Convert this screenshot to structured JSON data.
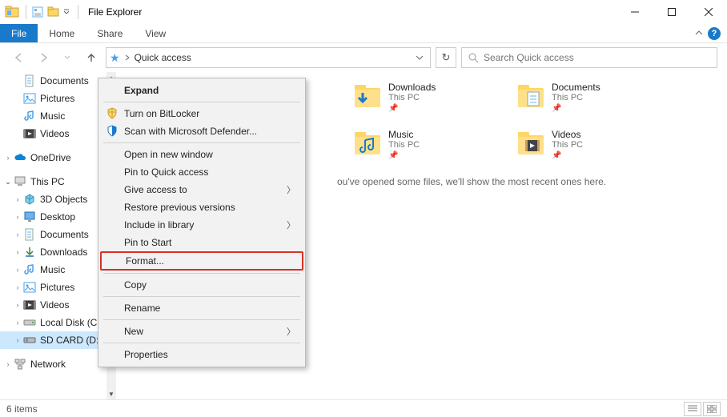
{
  "titlebar": {
    "title": "File Explorer"
  },
  "ribbon": {
    "file": "File",
    "tabs": [
      "Home",
      "Share",
      "View"
    ]
  },
  "address": {
    "location": "Quick access"
  },
  "search": {
    "placeholder": "Search Quick access"
  },
  "tree": {
    "qa": [
      {
        "label": "Documents",
        "icon": "doc"
      },
      {
        "label": "Pictures",
        "icon": "pic"
      },
      {
        "label": "Music",
        "icon": "music"
      },
      {
        "label": "Videos",
        "icon": "video"
      }
    ],
    "onedrive": "OneDrive",
    "thispc": "This PC",
    "pc": [
      {
        "label": "3D Objects",
        "icon": "3d"
      },
      {
        "label": "Desktop",
        "icon": "desktop"
      },
      {
        "label": "Documents",
        "icon": "doc"
      },
      {
        "label": "Downloads",
        "icon": "down"
      },
      {
        "label": "Music",
        "icon": "music"
      },
      {
        "label": "Pictures",
        "icon": "pic"
      },
      {
        "label": "Videos",
        "icon": "video"
      },
      {
        "label": "Local Disk (C:)",
        "icon": "disk"
      },
      {
        "label": "SD CARD (D:)",
        "icon": "sd"
      }
    ],
    "network": "Network"
  },
  "frequent": [
    {
      "name": "Downloads",
      "sub": "This PC",
      "icon": "down"
    },
    {
      "name": "Documents",
      "sub": "This PC",
      "icon": "doc"
    },
    {
      "name": "Music",
      "sub": "This PC",
      "icon": "music"
    },
    {
      "name": "Videos",
      "sub": "This PC",
      "icon": "video"
    }
  ],
  "hint": "ou've opened some files, we'll show the most recent ones here.",
  "context_menu": {
    "items": [
      {
        "label": "Expand",
        "bold": true
      },
      {
        "sep": true
      },
      {
        "label": "Turn on BitLocker",
        "icon": "shield"
      },
      {
        "label": "Scan with Microsoft Defender...",
        "icon": "defender"
      },
      {
        "sep": true
      },
      {
        "label": "Open in new window"
      },
      {
        "label": "Pin to Quick access"
      },
      {
        "label": "Give access to",
        "submenu": true
      },
      {
        "label": "Restore previous versions"
      },
      {
        "label": "Include in library",
        "submenu": true
      },
      {
        "label": "Pin to Start"
      },
      {
        "label": "Format...",
        "highlight": true
      },
      {
        "sep": true
      },
      {
        "label": "Copy"
      },
      {
        "sep": true
      },
      {
        "label": "Rename"
      },
      {
        "sep": true
      },
      {
        "label": "New",
        "submenu": true
      },
      {
        "sep": true
      },
      {
        "label": "Properties"
      }
    ]
  },
  "status": {
    "items": "6 items"
  }
}
